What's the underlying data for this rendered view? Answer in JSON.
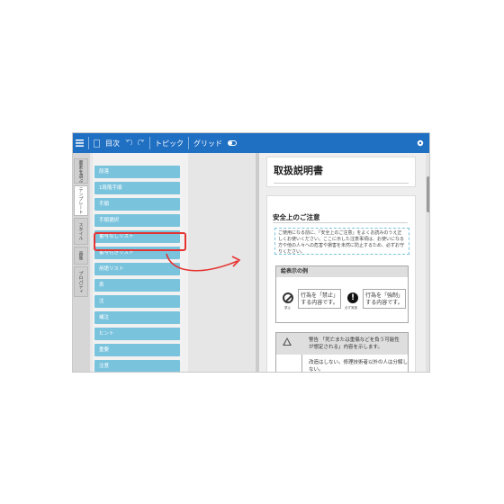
{
  "toolbar": {
    "menu_icon": "hamburger-icon",
    "items": [
      "目次",
      "トピック",
      "グリッド"
    ],
    "undo_icon": "undo-icon",
    "redo_icon": "redo-icon",
    "page_icon": "document-icon",
    "toggle_icon": "toggle-icon",
    "settings_icon": "gear-icon"
  },
  "vertical_tabs": [
    "要素を選ぶ",
    "テンプレート",
    "スタイル",
    "画像",
    "プロパティ"
  ],
  "block_list": [
    "段落",
    "1段階手順",
    "手順",
    "手順選択",
    "番号なしリスト",
    "番号付きリスト",
    "用語リスト",
    "表",
    "注",
    "補注",
    "ヒント",
    "重要",
    "注意"
  ],
  "document": {
    "title": "取扱説明書",
    "section_title": "安全上のご注意",
    "notice_text": "ご使用になる前に、「安全上のご注意」をよくお読みのうえ正しくお使いください。ここに示した注意事項は、お使いになる方や他の人々への危害や損害を未然に防止するため、必ずお守りください。",
    "legend": {
      "header": "絵表示の例",
      "prohibit_caption": "禁止",
      "prohibit_text": "行為を「禁止」する内容です。",
      "must_caption": "必ず実施",
      "must_text": "行為を「強制」する内容です。"
    },
    "warning": {
      "text": "警告 「死亡または重傷などを負う可能性が想定される」内容を示します。",
      "body": "改造はしない。修理技術者以外の人は分解しない。"
    }
  },
  "colors": {
    "toolbar": "#1f6fc3",
    "list_item": "#7ac3dd",
    "highlight": "#e53332"
  }
}
